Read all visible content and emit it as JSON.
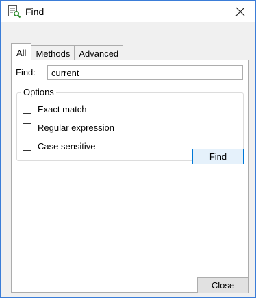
{
  "window": {
    "title": "Find",
    "icon": "find-in-list-icon",
    "close_glyph": "close-icon"
  },
  "tabs": [
    {
      "label": "All",
      "active": true
    },
    {
      "label": "Methods",
      "active": false
    },
    {
      "label": "Advanced",
      "active": false
    }
  ],
  "find": {
    "label": "Find:",
    "value": "current"
  },
  "options": {
    "legend": "Options",
    "items": [
      {
        "label": "Exact match",
        "checked": false
      },
      {
        "label": "Regular expression",
        "checked": false
      },
      {
        "label": "Case sensitive",
        "checked": false
      }
    ]
  },
  "buttons": {
    "find": "Find",
    "close": "Close"
  },
  "colors": {
    "accent_border": "#0078d7",
    "accent_fill": "#e5f1fb",
    "window_border": "#3b7dd8",
    "dialog_bg": "#f0f0f0"
  }
}
